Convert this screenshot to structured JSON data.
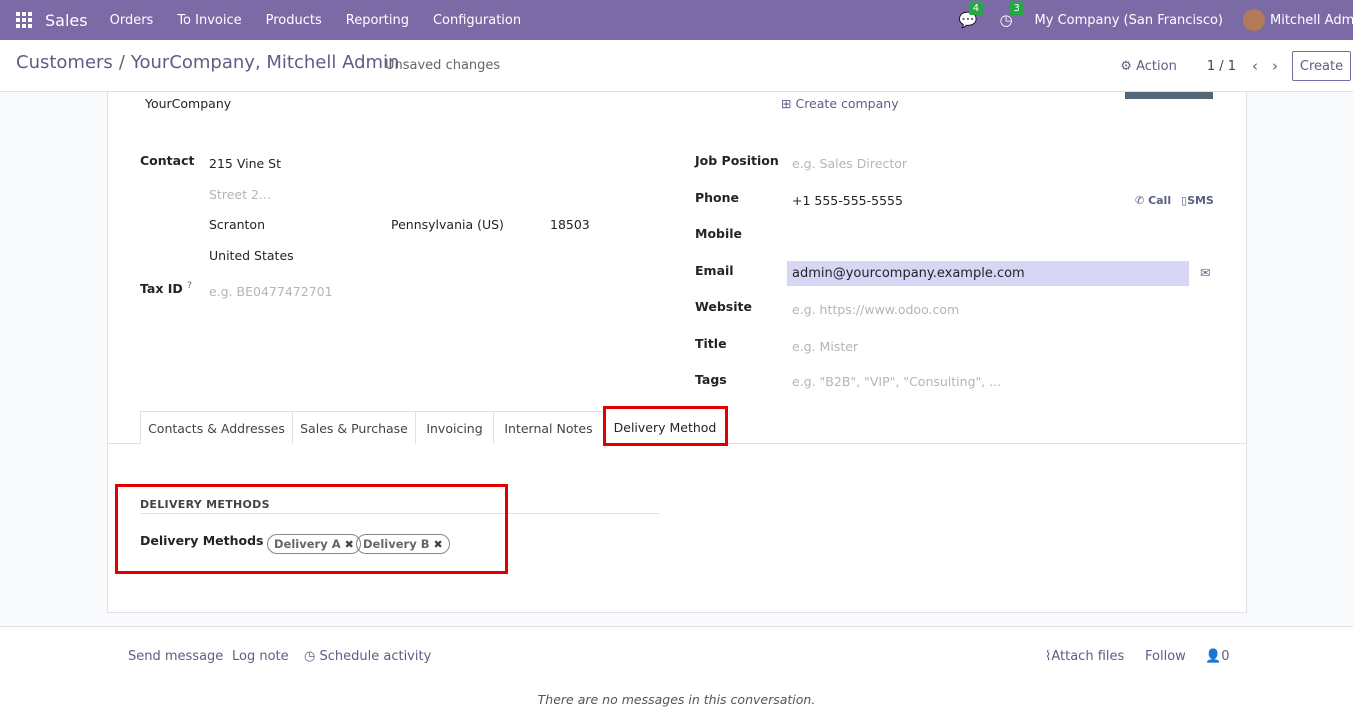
{
  "navbar": {
    "app_name": "Sales",
    "menu": [
      "Orders",
      "To Invoice",
      "Products",
      "Reporting",
      "Configuration"
    ],
    "messages_badge": "4",
    "activities_badge": "3",
    "company": "My Company (San Francisco)",
    "user": "Mitchell Admin"
  },
  "control_panel": {
    "breadcrumb_parent": "Customers",
    "breadcrumb_sep": "/",
    "breadcrumb_current": "YourCompany, Mitchell Admin",
    "unsaved": "Unsaved changes",
    "action": "Action",
    "pager": "1 / 1",
    "create": "Create"
  },
  "form": {
    "company_name": "YourCompany",
    "create_company": "Create company",
    "contact_label": "Contact",
    "street": "215 Vine St",
    "street2_placeholder": "Street 2...",
    "city": "Scranton",
    "state": "Pennsylvania (US)",
    "zip": "18503",
    "country": "United States",
    "tax_id_label": "Tax ID",
    "tax_id_help": "?",
    "tax_id_placeholder": "e.g. BE0477472701",
    "job_position_label": "Job Position",
    "job_position_placeholder": "e.g. Sales Director",
    "phone_label": "Phone",
    "phone": "+1 555-555-5555",
    "call": "Call",
    "sms": "SMS",
    "mobile_label": "Mobile",
    "email_label": "Email",
    "email": "admin@yourcompany.example.com",
    "website_label": "Website",
    "website_placeholder": "e.g. https://www.odoo.com",
    "title_label": "Title",
    "title_placeholder": "e.g. Mister",
    "tags_label": "Tags",
    "tags_placeholder": "e.g. \"B2B\", \"VIP\", \"Consulting\", ..."
  },
  "tabs": [
    "Contacts & Addresses",
    "Sales & Purchase",
    "Invoicing",
    "Internal Notes",
    "Delivery Method"
  ],
  "delivery": {
    "section_title": "DELIVERY METHODS",
    "field_label": "Delivery Methods",
    "tags": [
      "Delivery A",
      "Delivery B"
    ]
  },
  "chatter": {
    "send_message": "Send message",
    "log_note": "Log note",
    "schedule_activity": "Schedule activity",
    "attach_files": "Attach files",
    "follow": "Follow",
    "followers_count": "0",
    "no_messages": "There are no messages in this conversation."
  }
}
